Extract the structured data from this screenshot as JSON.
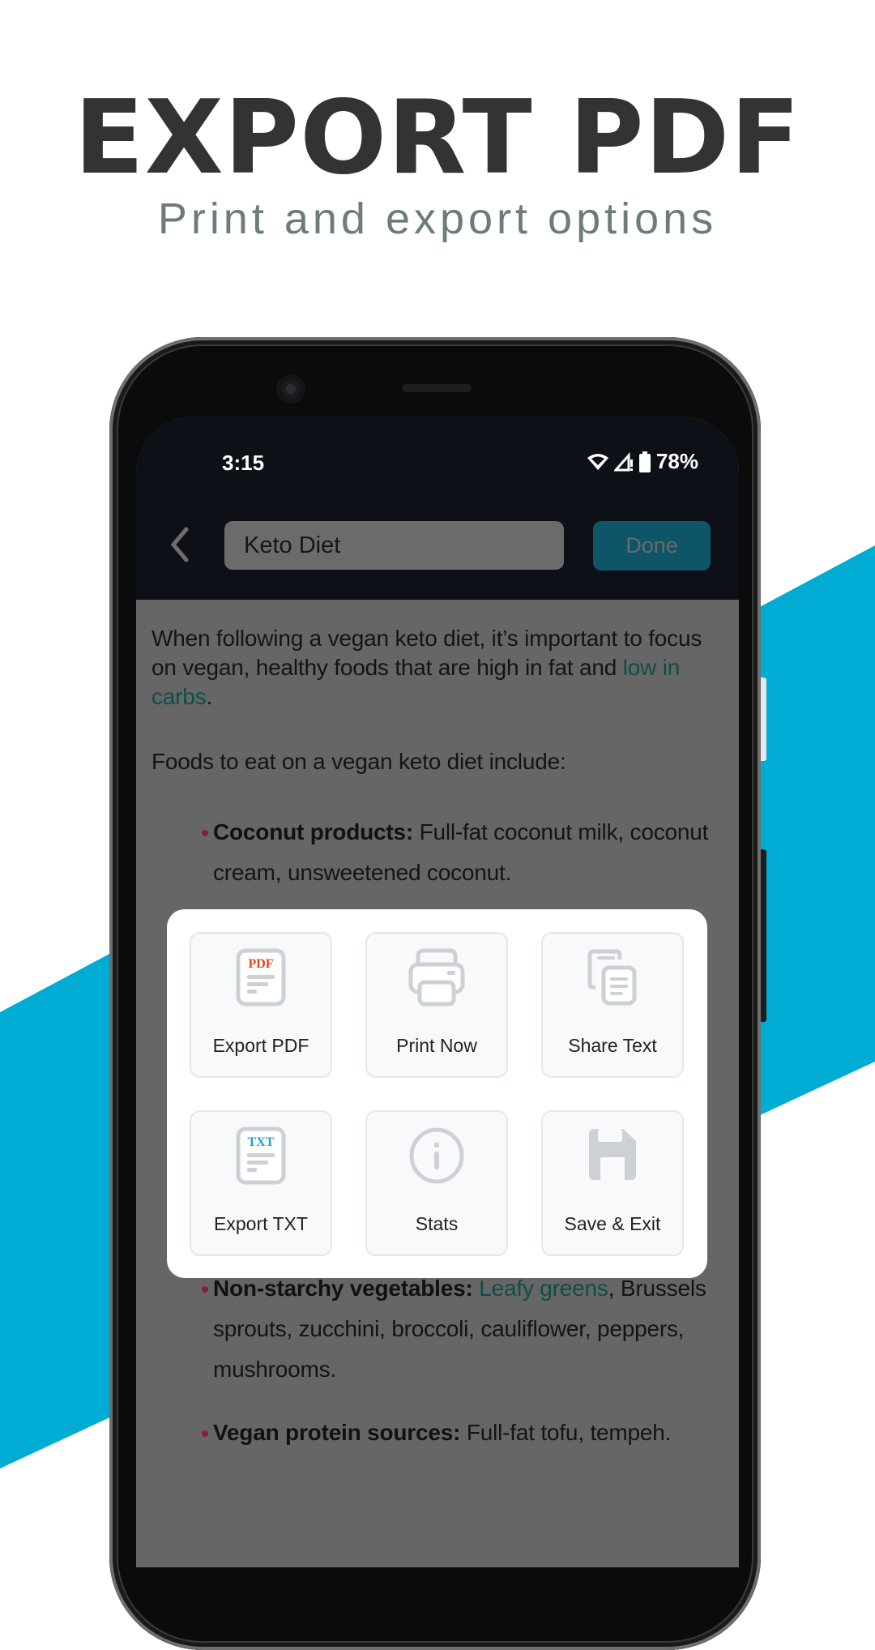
{
  "promo": {
    "title": "EXPORT PDF",
    "subtitle": "Print and export options"
  },
  "colors": {
    "band": "#00acd4",
    "pdf_label": "#e0461a",
    "txt_label": "#18a5c8",
    "icon_gray": "#cdd1d6",
    "bullet": "#8a1c4c",
    "link": "#0e4e48"
  },
  "status_bar": {
    "time": "3:15",
    "battery": "78%",
    "icons": [
      "wifi-icon",
      "signal-no-data-icon",
      "battery-icon"
    ]
  },
  "toolbar": {
    "back_icon": "chevron-left-icon",
    "title_value": "Keto Diet",
    "done_label": "Done"
  },
  "document": {
    "intro": {
      "text_before": "When following a vegan keto diet, it’s important to focus on vegan, healthy foods that are high in fat and ",
      "link": "low in carbs",
      "text_after": "."
    },
    "lead": "Foods to eat on a vegan keto diet include:",
    "items": [
      {
        "bold": "Coconut products:",
        "text": " Full-fat coconut milk, coconut cream, unsweetened coconut."
      },
      {
        "bold": "Non-starchy vegetables:",
        "link": "Leafy greens",
        "text": ", Brussels sprouts, zucchini, broccoli, cauliflower, peppers, mushrooms."
      },
      {
        "bold": "Vegan protein sources:",
        "text": " Full-fat tofu, tempeh."
      }
    ]
  },
  "menu": {
    "options": [
      {
        "label": "Export PDF",
        "icon": "pdf-file-icon",
        "badge": "PDF"
      },
      {
        "label": "Print Now",
        "icon": "printer-icon"
      },
      {
        "label": "Share Text",
        "icon": "copy-documents-icon"
      },
      {
        "label": "Export TXT",
        "icon": "txt-file-icon",
        "badge": "TXT"
      },
      {
        "label": "Stats",
        "icon": "info-icon"
      },
      {
        "label": "Save & Exit",
        "icon": "floppy-disk-icon"
      }
    ]
  }
}
